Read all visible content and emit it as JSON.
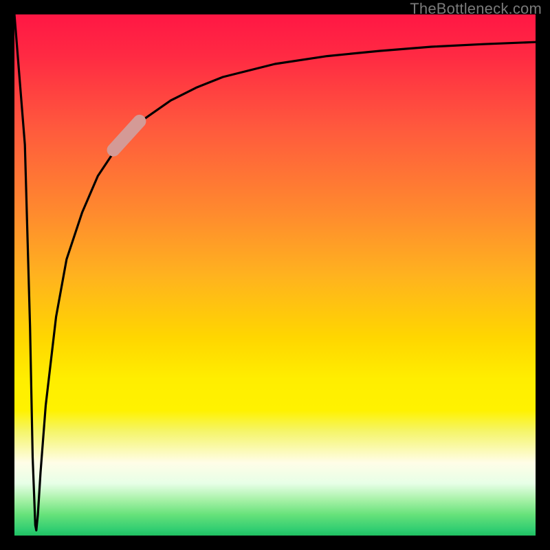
{
  "attribution": "TheBottleneck.com",
  "colors": {
    "curve_stroke": "#000000",
    "dot_fill": "#d49a96",
    "axis_stroke": "#000000",
    "attribution_text": "#7a7a7a"
  },
  "chart_data": {
    "type": "line",
    "title": "",
    "xlabel": "",
    "ylabel": "",
    "xlim": [
      0,
      100
    ],
    "ylim": [
      0,
      100
    ],
    "grid": false,
    "series": [
      {
        "name": "bottleneck-curve",
        "x": [
          0,
          2,
          3,
          3.5,
          4,
          4.2,
          4.5,
          5,
          6,
          8,
          10,
          13,
          16,
          20,
          25,
          30,
          35,
          40,
          50,
          60,
          70,
          80,
          90,
          100
        ],
        "values": [
          100,
          75,
          40,
          15,
          2,
          1,
          4,
          12,
          25,
          42,
          53,
          62,
          69,
          75,
          80,
          83.5,
          86,
          88,
          90.5,
          92,
          93,
          93.8,
          94.3,
          94.7
        ]
      }
    ],
    "annotations": [
      {
        "name": "highlight-dot",
        "shape": "segment",
        "x0": 19,
        "y0": 74,
        "x1": 24,
        "y1": 79.5,
        "color": "#d49a96"
      }
    ]
  }
}
